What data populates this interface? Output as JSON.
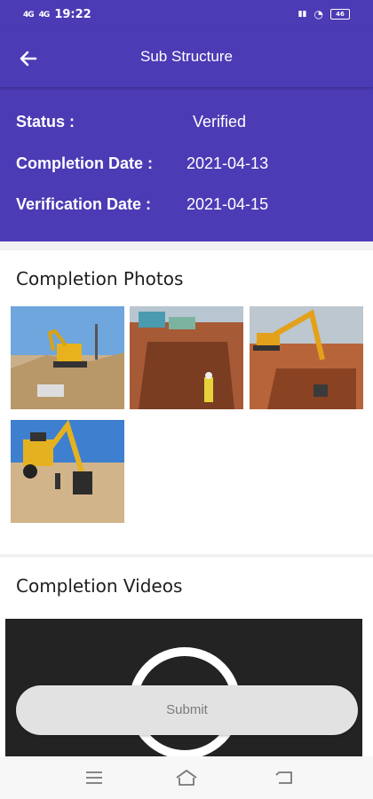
{
  "status_bar": {
    "signal_left": "4G",
    "signal_right": "4G",
    "time": "19:22",
    "battery": "46"
  },
  "app_bar": {
    "title": "Sub Structure"
  },
  "info": {
    "status_label": "Status :",
    "status_value": "Verified",
    "completion_label": "Completion Date :",
    "completion_value": "2021-04-13",
    "verification_label": "Verification Date :",
    "verification_value": "2021-04-15"
  },
  "photos": {
    "title": "Completion Photos",
    "items": [
      {
        "icon": "excavator-photo"
      },
      {
        "icon": "trench-photo"
      },
      {
        "icon": "excavator-trench-photo"
      },
      {
        "icon": "backhoe-photo"
      }
    ]
  },
  "videos": {
    "title": "Completion Videos"
  },
  "submit": {
    "label": "Submit"
  },
  "colors": {
    "primary": "#4b3bb5",
    "button": "#e2e2e2"
  }
}
